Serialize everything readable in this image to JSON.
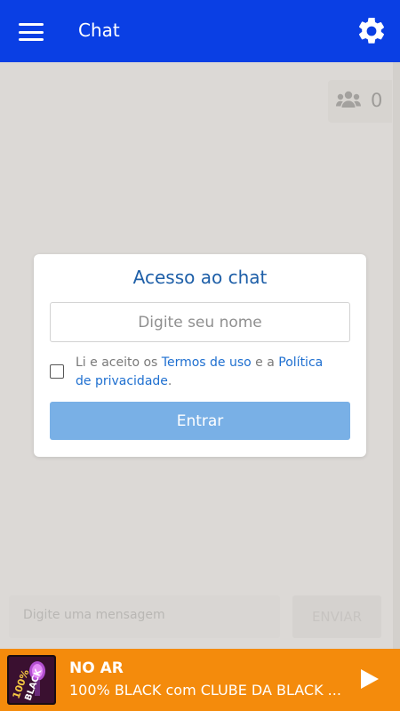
{
  "header": {
    "title": "Chat",
    "menu_icon": "hamburger-menu-icon",
    "settings_icon": "gear-icon"
  },
  "users_online": {
    "icon": "users-group-icon",
    "count": "0"
  },
  "login_modal": {
    "title": "Acesso ao chat",
    "name_placeholder": "Digite seu nome",
    "name_value": "",
    "agree_prefix": "Li e aceito os ",
    "terms_link": "Termos de uso",
    "agree_middle": " e a ",
    "privacy_link": "Política de privacidade",
    "agree_suffix": ".",
    "agree_checked": false,
    "enter_label": "Entrar"
  },
  "message_bar": {
    "placeholder": "Digite uma mensagem",
    "send_label": "ENVIAR"
  },
  "player": {
    "status": "NO AR",
    "track": "100% BLACK com CLUBE DA BLACK ...",
    "cover_icon": "album-cover-image",
    "play_icon": "play-icon"
  },
  "colors": {
    "header": "#0a3fe4",
    "link": "#1e6fd0",
    "title": "#1e5fa8",
    "button": "#79b0e6",
    "player": "#f48b0c"
  }
}
